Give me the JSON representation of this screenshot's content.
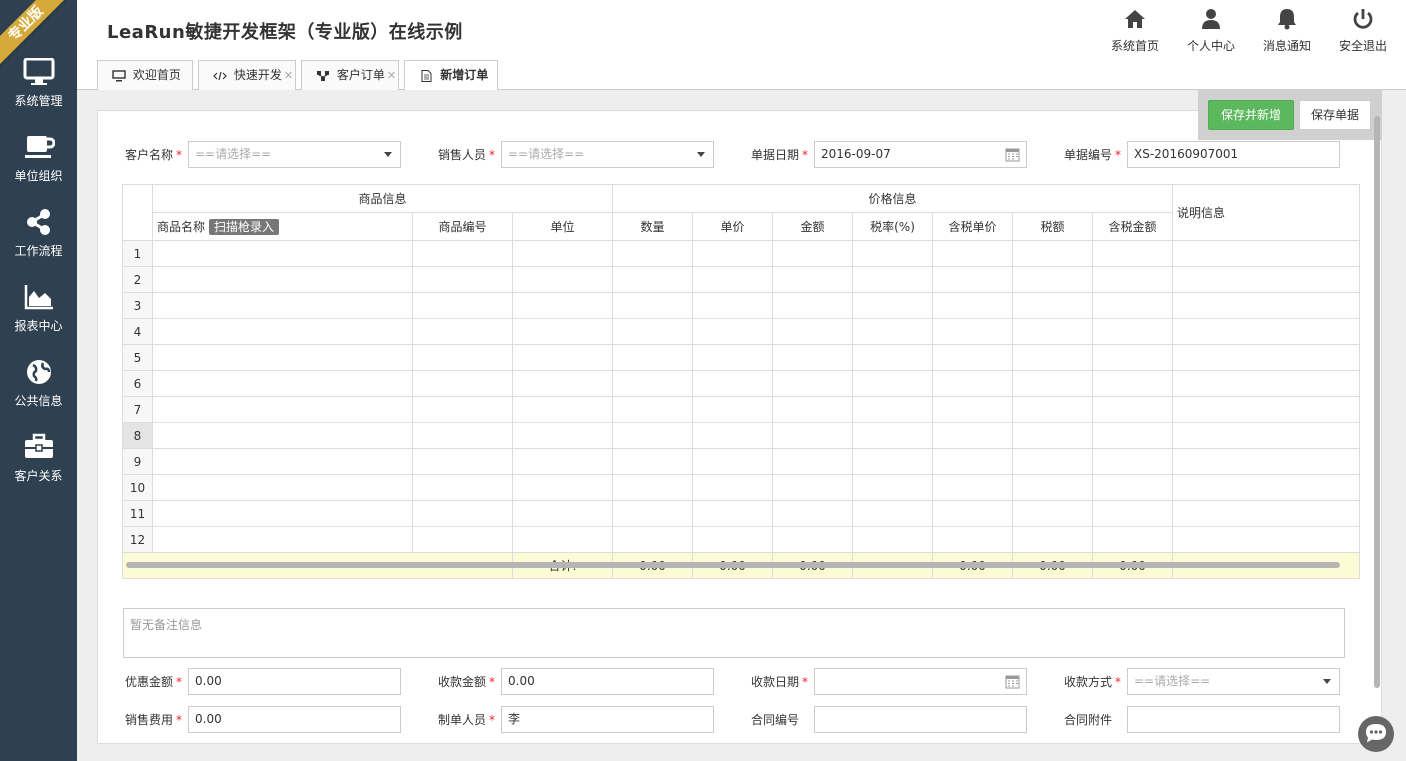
{
  "badge": "专业版",
  "sidebar": {
    "items": [
      {
        "label": "系统管理",
        "icon": "monitor-icon"
      },
      {
        "label": "单位组织",
        "icon": "coffee-icon"
      },
      {
        "label": "工作流程",
        "icon": "share-icon"
      },
      {
        "label": "报表中心",
        "icon": "area-chart-icon"
      },
      {
        "label": "公共信息",
        "icon": "globe-icon"
      },
      {
        "label": "客户关系",
        "icon": "briefcase-icon"
      }
    ]
  },
  "header": {
    "title": "LeaRun敏捷开发框架（专业版）在线示例",
    "buttons": [
      {
        "label": "系统首页",
        "icon": "home-icon"
      },
      {
        "label": "个人中心",
        "icon": "user-icon"
      },
      {
        "label": "消息通知",
        "icon": "bell-icon"
      },
      {
        "label": "安全退出",
        "icon": "power-icon"
      }
    ]
  },
  "tabs": [
    {
      "label": "欢迎首页",
      "icon": "desktop-icon",
      "closable": false
    },
    {
      "label": "快速开发",
      "icon": "code-icon",
      "closable": true
    },
    {
      "label": "客户订单",
      "icon": "sitemap-icon",
      "closable": true
    },
    {
      "label": "新增订单",
      "icon": "file-icon",
      "closable": true,
      "active": true
    }
  ],
  "actions": {
    "save_new": "保存并新增",
    "save": "保存单据"
  },
  "form": {
    "customer": {
      "label": "客户名称",
      "placeholder": "==请选择=="
    },
    "salesperson": {
      "label": "销售人员",
      "placeholder": "==请选择=="
    },
    "date": {
      "label": "单据日期",
      "value": "2016-09-07"
    },
    "number": {
      "label": "单据编号",
      "value": "XS-20160907001"
    },
    "discount": {
      "label": "优惠金额",
      "value": "0.00"
    },
    "received": {
      "label": "收款金额",
      "value": "0.00"
    },
    "recv_date": {
      "label": "收款日期",
      "value": ""
    },
    "recv_method": {
      "label": "收款方式",
      "placeholder": "==请选择=="
    },
    "sales_fee": {
      "label": "销售费用",
      "value": "0.00"
    },
    "creator": {
      "label": "制单人员",
      "value": "李"
    },
    "contract_no": {
      "label": "合同编号",
      "value": ""
    },
    "contract_file": {
      "label": "合同附件",
      "value": ""
    }
  },
  "grid": {
    "group_product": "商品信息",
    "group_price": "价格信息",
    "col_desc": "说明信息",
    "col_name": "商品名称",
    "scan_label": "扫描枪录入",
    "col_code": "商品编号",
    "col_unit": "单位",
    "col_qty": "数量",
    "col_price": "单价",
    "col_amount": "金额",
    "col_taxrate": "税率(%)",
    "col_taxprice": "含税单价",
    "col_tax": "税额",
    "col_taxamount": "含税金额",
    "rows": [
      "1",
      "2",
      "3",
      "4",
      "5",
      "6",
      "7",
      "8",
      "9",
      "10",
      "11",
      "12"
    ],
    "highlight_row": 8,
    "sum_label": "合计:",
    "sums": {
      "qty": "0.00",
      "price": "0.00",
      "amount": "0.00",
      "taxprice": "0.00",
      "tax": "0.00",
      "taxamount": "0.00"
    }
  },
  "remark_placeholder": "暂无备注信息",
  "colors": {
    "sidebar": "#2f4050",
    "badge": "#d6aa3a",
    "primary": "#5cb85c",
    "sum_bg": "#fdfbd6"
  }
}
